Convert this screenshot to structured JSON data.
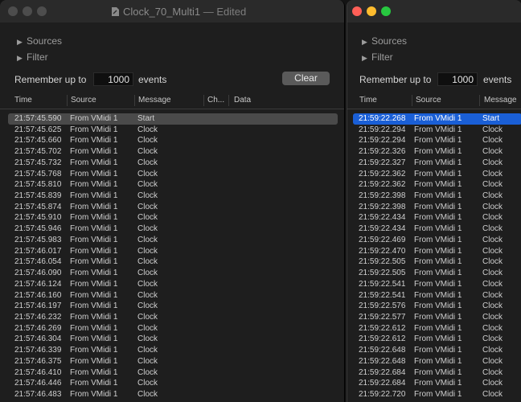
{
  "left_window": {
    "title": "Clock_70_Multi1",
    "title_suffix": "— Edited",
    "sources_label": "Sources",
    "filter_label": "Filter",
    "remember_label": "Remember up to",
    "remember_value": "1000",
    "events_label": "events",
    "clear_label": "Clear",
    "columns": [
      "Time",
      "Source",
      "Message",
      "Ch...",
      "Data"
    ],
    "rows": [
      [
        "21:57:45.590",
        "From VMidi 1",
        "Start"
      ],
      [
        "21:57:45.625",
        "From VMidi 1",
        "Clock"
      ],
      [
        "21:57:45.660",
        "From VMidi 1",
        "Clock"
      ],
      [
        "21:57:45.702",
        "From VMidi 1",
        "Clock"
      ],
      [
        "21:57:45.732",
        "From VMidi 1",
        "Clock"
      ],
      [
        "21:57:45.768",
        "From VMidi 1",
        "Clock"
      ],
      [
        "21:57:45.810",
        "From VMidi 1",
        "Clock"
      ],
      [
        "21:57:45.839",
        "From VMidi 1",
        "Clock"
      ],
      [
        "21:57:45.874",
        "From VMidi 1",
        "Clock"
      ],
      [
        "21:57:45.910",
        "From VMidi 1",
        "Clock"
      ],
      [
        "21:57:45.946",
        "From VMidi 1",
        "Clock"
      ],
      [
        "21:57:45.983",
        "From VMidi 1",
        "Clock"
      ],
      [
        "21:57:46.017",
        "From VMidi 1",
        "Clock"
      ],
      [
        "21:57:46.054",
        "From VMidi 1",
        "Clock"
      ],
      [
        "21:57:46.090",
        "From VMidi 1",
        "Clock"
      ],
      [
        "21:57:46.124",
        "From VMidi 1",
        "Clock"
      ],
      [
        "21:57:46.160",
        "From VMidi 1",
        "Clock"
      ],
      [
        "21:57:46.197",
        "From VMidi 1",
        "Clock"
      ],
      [
        "21:57:46.232",
        "From VMidi 1",
        "Clock"
      ],
      [
        "21:57:46.269",
        "From VMidi 1",
        "Clock"
      ],
      [
        "21:57:46.304",
        "From VMidi 1",
        "Clock"
      ],
      [
        "21:57:46.339",
        "From VMidi 1",
        "Clock"
      ],
      [
        "21:57:46.375",
        "From VMidi 1",
        "Clock"
      ],
      [
        "21:57:46.410",
        "From VMidi 1",
        "Clock"
      ],
      [
        "21:57:46.446",
        "From VMidi 1",
        "Clock"
      ],
      [
        "21:57:46.483",
        "From VMidi 1",
        "Clock"
      ]
    ]
  },
  "right_window": {
    "sources_label": "Sources",
    "filter_label": "Filter",
    "remember_label": "Remember up to",
    "remember_value": "1000",
    "events_label": "events",
    "columns": [
      "Time",
      "Source",
      "Message"
    ],
    "rows": [
      [
        "21:59:22.268",
        "From VMidi 1",
        "Start"
      ],
      [
        "21:59:22.294",
        "From VMidi 1",
        "Clock"
      ],
      [
        "21:59:22.294",
        "From VMidi 1",
        "Clock"
      ],
      [
        "21:59:22.326",
        "From VMidi 1",
        "Clock"
      ],
      [
        "21:59:22.327",
        "From VMidi 1",
        "Clock"
      ],
      [
        "21:59:22.362",
        "From VMidi 1",
        "Clock"
      ],
      [
        "21:59:22.362",
        "From VMidi 1",
        "Clock"
      ],
      [
        "21:59:22.398",
        "From VMidi 1",
        "Clock"
      ],
      [
        "21:59:22.398",
        "From VMidi 1",
        "Clock"
      ],
      [
        "21:59:22.434",
        "From VMidi 1",
        "Clock"
      ],
      [
        "21:59:22.434",
        "From VMidi 1",
        "Clock"
      ],
      [
        "21:59:22.469",
        "From VMidi 1",
        "Clock"
      ],
      [
        "21:59:22.470",
        "From VMidi 1",
        "Clock"
      ],
      [
        "21:59:22.505",
        "From VMidi 1",
        "Clock"
      ],
      [
        "21:59:22.505",
        "From VMidi 1",
        "Clock"
      ],
      [
        "21:59:22.541",
        "From VMidi 1",
        "Clock"
      ],
      [
        "21:59:22.541",
        "From VMidi 1",
        "Clock"
      ],
      [
        "21:59:22.576",
        "From VMidi 1",
        "Clock"
      ],
      [
        "21:59:22.577",
        "From VMidi 1",
        "Clock"
      ],
      [
        "21:59:22.612",
        "From VMidi 1",
        "Clock"
      ],
      [
        "21:59:22.612",
        "From VMidi 1",
        "Clock"
      ],
      [
        "21:59:22.648",
        "From VMidi 1",
        "Clock"
      ],
      [
        "21:59:22.648",
        "From VMidi 1",
        "Clock"
      ],
      [
        "21:59:22.684",
        "From VMidi 1",
        "Clock"
      ],
      [
        "21:59:22.684",
        "From VMidi 1",
        "Clock"
      ],
      [
        "21:59:22.720",
        "From VMidi 1",
        "Clock"
      ]
    ]
  },
  "colors": {
    "close": "#ff5f57",
    "minimize": "#febc2e",
    "zoom": "#28c840",
    "inactive_light": "#4d4d4d",
    "selection_active": "#1a5fd6",
    "selection_inactive": "#4a4a4a"
  }
}
